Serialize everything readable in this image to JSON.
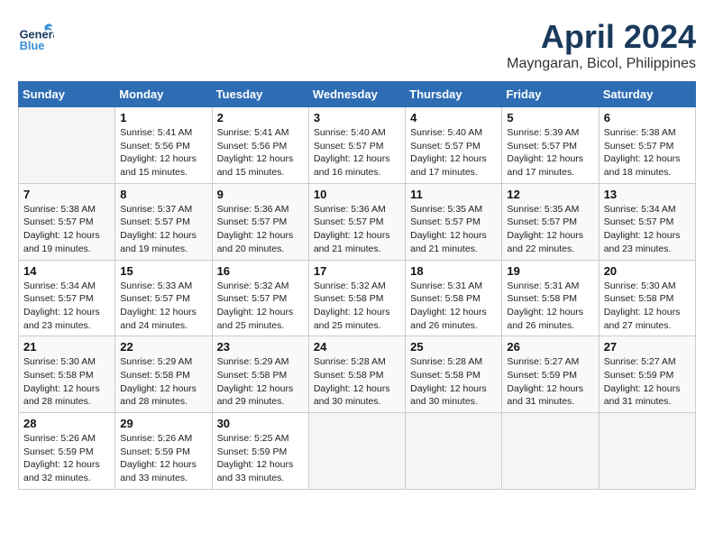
{
  "header": {
    "logo_general": "General",
    "logo_blue": "Blue",
    "month": "April 2024",
    "location": "Mayngaran, Bicol, Philippines"
  },
  "weekdays": [
    "Sunday",
    "Monday",
    "Tuesday",
    "Wednesday",
    "Thursday",
    "Friday",
    "Saturday"
  ],
  "weeks": [
    [
      {
        "day": "",
        "sunrise": "",
        "sunset": "",
        "daylight": ""
      },
      {
        "day": "1",
        "sunrise": "Sunrise: 5:41 AM",
        "sunset": "Sunset: 5:56 PM",
        "daylight": "Daylight: 12 hours and 15 minutes."
      },
      {
        "day": "2",
        "sunrise": "Sunrise: 5:41 AM",
        "sunset": "Sunset: 5:56 PM",
        "daylight": "Daylight: 12 hours and 15 minutes."
      },
      {
        "day": "3",
        "sunrise": "Sunrise: 5:40 AM",
        "sunset": "Sunset: 5:57 PM",
        "daylight": "Daylight: 12 hours and 16 minutes."
      },
      {
        "day": "4",
        "sunrise": "Sunrise: 5:40 AM",
        "sunset": "Sunset: 5:57 PM",
        "daylight": "Daylight: 12 hours and 17 minutes."
      },
      {
        "day": "5",
        "sunrise": "Sunrise: 5:39 AM",
        "sunset": "Sunset: 5:57 PM",
        "daylight": "Daylight: 12 hours and 17 minutes."
      },
      {
        "day": "6",
        "sunrise": "Sunrise: 5:38 AM",
        "sunset": "Sunset: 5:57 PM",
        "daylight": "Daylight: 12 hours and 18 minutes."
      }
    ],
    [
      {
        "day": "7",
        "sunrise": "Sunrise: 5:38 AM",
        "sunset": "Sunset: 5:57 PM",
        "daylight": "Daylight: 12 hours and 19 minutes."
      },
      {
        "day": "8",
        "sunrise": "Sunrise: 5:37 AM",
        "sunset": "Sunset: 5:57 PM",
        "daylight": "Daylight: 12 hours and 19 minutes."
      },
      {
        "day": "9",
        "sunrise": "Sunrise: 5:36 AM",
        "sunset": "Sunset: 5:57 PM",
        "daylight": "Daylight: 12 hours and 20 minutes."
      },
      {
        "day": "10",
        "sunrise": "Sunrise: 5:36 AM",
        "sunset": "Sunset: 5:57 PM",
        "daylight": "Daylight: 12 hours and 21 minutes."
      },
      {
        "day": "11",
        "sunrise": "Sunrise: 5:35 AM",
        "sunset": "Sunset: 5:57 PM",
        "daylight": "Daylight: 12 hours and 21 minutes."
      },
      {
        "day": "12",
        "sunrise": "Sunrise: 5:35 AM",
        "sunset": "Sunset: 5:57 PM",
        "daylight": "Daylight: 12 hours and 22 minutes."
      },
      {
        "day": "13",
        "sunrise": "Sunrise: 5:34 AM",
        "sunset": "Sunset: 5:57 PM",
        "daylight": "Daylight: 12 hours and 23 minutes."
      }
    ],
    [
      {
        "day": "14",
        "sunrise": "Sunrise: 5:34 AM",
        "sunset": "Sunset: 5:57 PM",
        "daylight": "Daylight: 12 hours and 23 minutes."
      },
      {
        "day": "15",
        "sunrise": "Sunrise: 5:33 AM",
        "sunset": "Sunset: 5:57 PM",
        "daylight": "Daylight: 12 hours and 24 minutes."
      },
      {
        "day": "16",
        "sunrise": "Sunrise: 5:32 AM",
        "sunset": "Sunset: 5:57 PM",
        "daylight": "Daylight: 12 hours and 25 minutes."
      },
      {
        "day": "17",
        "sunrise": "Sunrise: 5:32 AM",
        "sunset": "Sunset: 5:58 PM",
        "daylight": "Daylight: 12 hours and 25 minutes."
      },
      {
        "day": "18",
        "sunrise": "Sunrise: 5:31 AM",
        "sunset": "Sunset: 5:58 PM",
        "daylight": "Daylight: 12 hours and 26 minutes."
      },
      {
        "day": "19",
        "sunrise": "Sunrise: 5:31 AM",
        "sunset": "Sunset: 5:58 PM",
        "daylight": "Daylight: 12 hours and 26 minutes."
      },
      {
        "day": "20",
        "sunrise": "Sunrise: 5:30 AM",
        "sunset": "Sunset: 5:58 PM",
        "daylight": "Daylight: 12 hours and 27 minutes."
      }
    ],
    [
      {
        "day": "21",
        "sunrise": "Sunrise: 5:30 AM",
        "sunset": "Sunset: 5:58 PM",
        "daylight": "Daylight: 12 hours and 28 minutes."
      },
      {
        "day": "22",
        "sunrise": "Sunrise: 5:29 AM",
        "sunset": "Sunset: 5:58 PM",
        "daylight": "Daylight: 12 hours and 28 minutes."
      },
      {
        "day": "23",
        "sunrise": "Sunrise: 5:29 AM",
        "sunset": "Sunset: 5:58 PM",
        "daylight": "Daylight: 12 hours and 29 minutes."
      },
      {
        "day": "24",
        "sunrise": "Sunrise: 5:28 AM",
        "sunset": "Sunset: 5:58 PM",
        "daylight": "Daylight: 12 hours and 30 minutes."
      },
      {
        "day": "25",
        "sunrise": "Sunrise: 5:28 AM",
        "sunset": "Sunset: 5:58 PM",
        "daylight": "Daylight: 12 hours and 30 minutes."
      },
      {
        "day": "26",
        "sunrise": "Sunrise: 5:27 AM",
        "sunset": "Sunset: 5:59 PM",
        "daylight": "Daylight: 12 hours and 31 minutes."
      },
      {
        "day": "27",
        "sunrise": "Sunrise: 5:27 AM",
        "sunset": "Sunset: 5:59 PM",
        "daylight": "Daylight: 12 hours and 31 minutes."
      }
    ],
    [
      {
        "day": "28",
        "sunrise": "Sunrise: 5:26 AM",
        "sunset": "Sunset: 5:59 PM",
        "daylight": "Daylight: 12 hours and 32 minutes."
      },
      {
        "day": "29",
        "sunrise": "Sunrise: 5:26 AM",
        "sunset": "Sunset: 5:59 PM",
        "daylight": "Daylight: 12 hours and 33 minutes."
      },
      {
        "day": "30",
        "sunrise": "Sunrise: 5:25 AM",
        "sunset": "Sunset: 5:59 PM",
        "daylight": "Daylight: 12 hours and 33 minutes."
      },
      {
        "day": "",
        "sunrise": "",
        "sunset": "",
        "daylight": ""
      },
      {
        "day": "",
        "sunrise": "",
        "sunset": "",
        "daylight": ""
      },
      {
        "day": "",
        "sunrise": "",
        "sunset": "",
        "daylight": ""
      },
      {
        "day": "",
        "sunrise": "",
        "sunset": "",
        "daylight": ""
      }
    ]
  ]
}
